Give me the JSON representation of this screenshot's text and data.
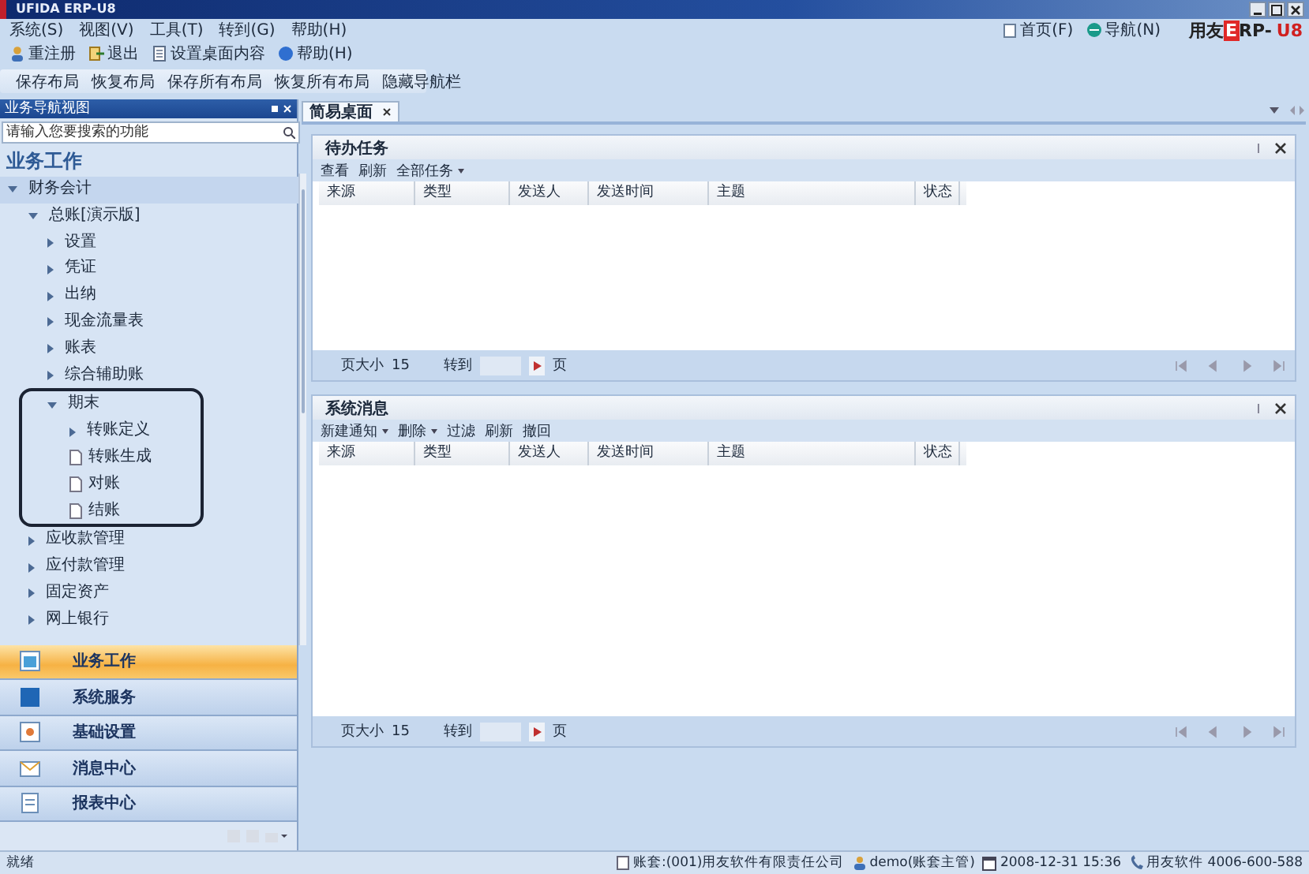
{
  "window": {
    "title": "UFIDA ERP-U8"
  },
  "menu": [
    "系统(S)",
    "视图(V)",
    "工具(T)",
    "转到(G)",
    "帮助(H)"
  ],
  "toolbar": [
    "重注册",
    "退出",
    "设置桌面内容",
    "帮助(H)"
  ],
  "layout_toolbar": [
    "保存布局",
    "恢复布局",
    "保存所有布局",
    "恢复所有布局",
    "隐藏导航栏"
  ],
  "header_links": [
    "首页(F)",
    "导航(N)"
  ],
  "logo": {
    "brand": "用友",
    "mark": "E",
    "rest": "RP-",
    "edition": "U8"
  },
  "nav_panel": {
    "title": "业务导航视图",
    "search": {
      "placeholder": "请输入您要搜索的功能"
    },
    "heading": "业务工作",
    "tree": [
      {
        "label": "财务会计",
        "kind": "folder",
        "expanded": true,
        "children": [
          {
            "label": "总账[演示版]",
            "kind": "folder",
            "expanded": true,
            "children": [
              {
                "label": "设置",
                "kind": "folder",
                "expanded": false
              },
              {
                "label": "凭证",
                "kind": "folder",
                "expanded": false
              },
              {
                "label": "出纳",
                "kind": "folder",
                "expanded": false
              },
              {
                "label": "现金流量表",
                "kind": "folder",
                "expanded": false
              },
              {
                "label": "账表",
                "kind": "folder",
                "expanded": false
              },
              {
                "label": "综合辅助账",
                "kind": "folder",
                "expanded": false
              },
              {
                "label": "期末",
                "kind": "folder",
                "expanded": true,
                "outlined": true,
                "children": [
                  {
                    "label": "转账定义",
                    "kind": "folder",
                    "expanded": false
                  },
                  {
                    "label": "转账生成",
                    "kind": "doc"
                  },
                  {
                    "label": "对账",
                    "kind": "doc"
                  },
                  {
                    "label": "结账",
                    "kind": "doc"
                  }
                ]
              }
            ]
          },
          {
            "label": "应收款管理",
            "kind": "folder",
            "expanded": false
          },
          {
            "label": "应付款管理",
            "kind": "folder",
            "expanded": false
          },
          {
            "label": "固定资产",
            "kind": "folder",
            "expanded": false
          },
          {
            "label": "网上银行",
            "kind": "folder",
            "expanded": false
          }
        ]
      }
    ]
  },
  "nav_buttons": [
    {
      "label": "业务工作",
      "selected": true
    },
    {
      "label": "系统服务",
      "selected": false
    },
    {
      "label": "基础设置",
      "selected": false
    },
    {
      "label": "消息中心",
      "selected": false
    },
    {
      "label": "报表中心",
      "selected": false
    }
  ],
  "tabs": [
    {
      "label": "简易桌面",
      "selected": true
    }
  ],
  "panels": [
    {
      "title": "待办任务",
      "actions": [
        {
          "label": "查看",
          "dropdown": false
        },
        {
          "label": "刷新",
          "dropdown": false
        },
        {
          "label": "全部任务",
          "dropdown": true
        }
      ],
      "columns": [
        "来源",
        "类型",
        "发送人",
        "发送时间",
        "主题",
        "状态"
      ],
      "pager": {
        "size_label": "页大小",
        "size": "15",
        "goto_label": "转到",
        "page_label": "页"
      }
    },
    {
      "title": "系统消息",
      "actions": [
        {
          "label": "新建通知",
          "dropdown": true
        },
        {
          "label": "删除",
          "dropdown": true
        },
        {
          "label": "过滤",
          "dropdown": false
        },
        {
          "label": "刷新",
          "dropdown": false
        },
        {
          "label": "撤回",
          "dropdown": false
        }
      ],
      "columns": [
        "来源",
        "类型",
        "发送人",
        "发送时间",
        "主题",
        "状态"
      ],
      "pager": {
        "size_label": "页大小",
        "size": "15",
        "goto_label": "转到",
        "page_label": "页"
      }
    }
  ],
  "status_bar": {
    "left": "就绪",
    "items": [
      "账套:(001)用友软件有限责任公司",
      "demo(账套主管)",
      "2008-12-31 15:36",
      "用友软件 4006-600-588"
    ]
  }
}
